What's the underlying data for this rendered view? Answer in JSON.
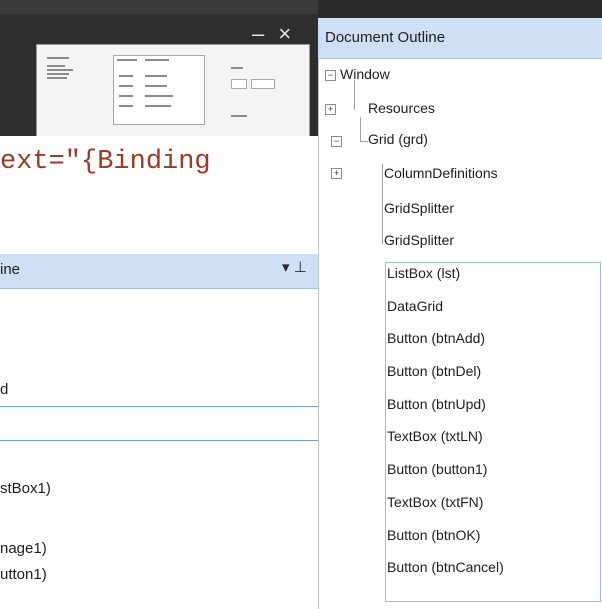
{
  "editor": {
    "code_fragment": "ext=\"{Binding",
    "window_controls": "– ×"
  },
  "outline_main": {
    "title": "Document Outline",
    "tree": [
      {
        "label": "Window",
        "expander": "−"
      },
      {
        "label": "Resources",
        "expander": "+"
      },
      {
        "label": "Grid (grd)",
        "expander": "−"
      },
      {
        "label": "ColumnDefinitions",
        "expander": "+"
      },
      {
        "label": "GridSplitter"
      },
      {
        "label": "GridSplitter"
      },
      {
        "label": "ListBox (lst)"
      },
      {
        "label": "DataGrid"
      },
      {
        "label": "Button (btnAdd)"
      },
      {
        "label": "Button (btnDel)"
      },
      {
        "label": "Button (btnUpd)"
      },
      {
        "label": "TextBox (txtLN)"
      },
      {
        "label": "Button (button1)"
      },
      {
        "label": "TextBox (txtFN)"
      },
      {
        "label": "Button (btnOK)"
      },
      {
        "label": "Button (btnCancel)"
      }
    ]
  },
  "outline_secondary": {
    "title": "ine",
    "pin": "▾ ⊥",
    "close": "✕",
    "rows": [
      "d",
      "",
      "stBox1)",
      "nage1)",
      "utton1)"
    ]
  }
}
